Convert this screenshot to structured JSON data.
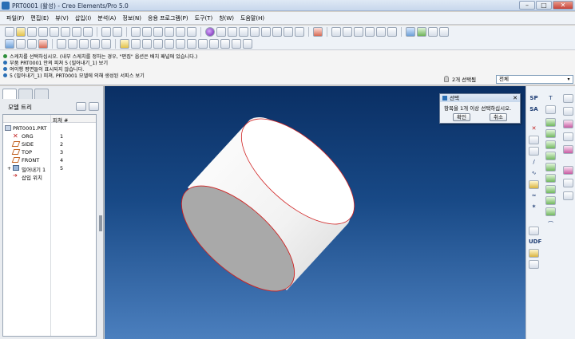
{
  "window": {
    "title": "PRT0001 (활성) - Creo Elements/Pro 5.0",
    "controls": [
      "–",
      "□",
      "✕"
    ]
  },
  "menu": [
    "파일(F)",
    "편집(E)",
    "뷰(V)",
    "삽입(I)",
    "분석(A)",
    "정보(N)",
    "응용 프로그램(P)",
    "도구(T)",
    "창(W)",
    "도움말(H)"
  ],
  "messages": [
    "스케치를 선택하십시오. (내부 스케치를 정하는 경우, \"편집\" 옵션은 배치 패널에 있습니다.)",
    "부품 PRT0001 안의 피쳐 5 (밀어내기_1) 보기",
    "여이행 평면들이 표시되지 않습니다.",
    "5 (밀어내기_1) 피쳐, PRT0001 모델에 의해 생성된 서피스 보기"
  ],
  "selection_status": "2개 선택됨",
  "filter": "전체",
  "panel": {
    "title": "모델 트리",
    "column_header": "피쳐 #",
    "root": "PRT0001.PRT",
    "items": [
      {
        "label": "ORG",
        "num": "1",
        "icon": "csys-icon"
      },
      {
        "label": "SIDE",
        "num": "2",
        "icon": "datum-plane-icon"
      },
      {
        "label": "TOP",
        "num": "3",
        "icon": "datum-plane-icon"
      },
      {
        "label": "FRONT",
        "num": "4",
        "icon": "datum-plane-icon"
      },
      {
        "label": "밀어내기 1",
        "num": "5",
        "icon": "extrude-icon"
      },
      {
        "label": "삽입 위치",
        "num": "",
        "icon": "insert-here-icon"
      }
    ]
  },
  "dialog": {
    "title": "선택",
    "message": "항목을 1개 이상 선택하십시오.",
    "ok": "확인",
    "cancel": "취소"
  },
  "right_tools": {
    "sketch_point": "SP",
    "analysis": "SA",
    "udf": "UDF"
  },
  "colors": {
    "background_top": "#0a2f64",
    "background_bottom": "#4b7fbe",
    "edge_highlight": "#d02020"
  }
}
